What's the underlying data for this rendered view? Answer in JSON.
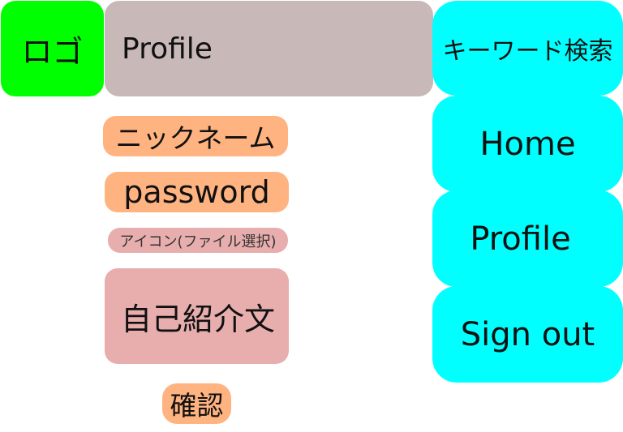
{
  "colors": {
    "logo_bg": "#00ff00",
    "title_bg": "#c8b8b8",
    "nav_bg": "#00ffff",
    "field_orange": "#ffb380",
    "field_pink": "#e8aeae"
  },
  "header": {
    "logo": "ロゴ",
    "title": "Profile"
  },
  "nav": {
    "search": "キーワード検索",
    "home": "Home",
    "profile": "Profile",
    "signout": "Sign out"
  },
  "form": {
    "nickname": "ニックネーム",
    "password": "password",
    "icon_select": "アイコン(ファイル選択)",
    "bio": "自己紹介文",
    "confirm": "確認"
  }
}
